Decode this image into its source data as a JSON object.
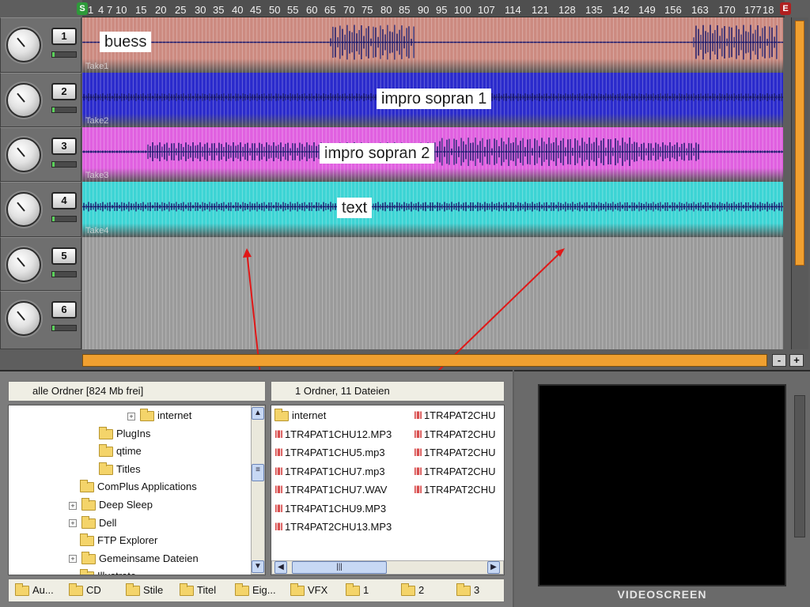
{
  "ruler": {
    "start_marker": "S",
    "end_marker": "E",
    "ticks": [
      "1",
      "4",
      "7",
      "10",
      "15",
      "20",
      "25",
      "30",
      "35",
      "40",
      "45",
      "50",
      "55",
      "60",
      "65",
      "70",
      "75",
      "80",
      "85",
      "90",
      "95",
      "100",
      "107",
      "114",
      "121",
      "128",
      "135",
      "142",
      "149",
      "156",
      "163",
      "170",
      "177",
      "18"
    ]
  },
  "tracks": [
    {
      "number": "1",
      "clip_name": "buess",
      "take": "Take1",
      "color": "#cc8a80"
    },
    {
      "number": "2",
      "clip_name": "impro sopran 1",
      "take": "Take2",
      "color": "#2a2acc"
    },
    {
      "number": "3",
      "clip_name": "impro sopran 2",
      "take": "Take3",
      "color": "#e060e0"
    },
    {
      "number": "4",
      "clip_name": "text",
      "take": "Take4",
      "color": "#3cd4d4"
    },
    {
      "number": "5",
      "clip_name": "",
      "take": ""
    },
    {
      "number": "6",
      "clip_name": "",
      "take": ""
    }
  ],
  "zoom": {
    "minus": "-",
    "plus": "+"
  },
  "explorer": {
    "folders_header": "alle Ordner [824 Mb frei]",
    "files_header": "1 Ordner, 11 Dateien",
    "tree": [
      "internet",
      "PlugIns",
      "qtime",
      "Titles",
      "ComPlus Applications",
      "Deep Sleep",
      "Dell",
      "FTP Explorer",
      "Gemeinsame Dateien",
      "Illustrate"
    ],
    "files_col1": [
      "internet",
      "1TR4PAT1CHU12.MP3",
      "1TR4PAT1CHU5.mp3",
      "1TR4PAT1CHU7.mp3",
      "1TR4PAT1CHU7.WAV",
      "1TR4PAT1CHU9.MP3",
      "1TR4PAT2CHU13.MP3"
    ],
    "files_col2": [
      "1TR4PAT2CHU",
      "1TR4PAT2CHU",
      "1TR4PAT2CHU",
      "1TR4PAT2CHU",
      "1TR4PAT2CHU"
    ],
    "bottom_folders": [
      "Au...",
      "CD",
      "Stile",
      "Titel",
      "Eig...",
      "VFX",
      "1",
      "2",
      "3"
    ]
  },
  "video": {
    "label": "VIDEOSCREEN"
  }
}
